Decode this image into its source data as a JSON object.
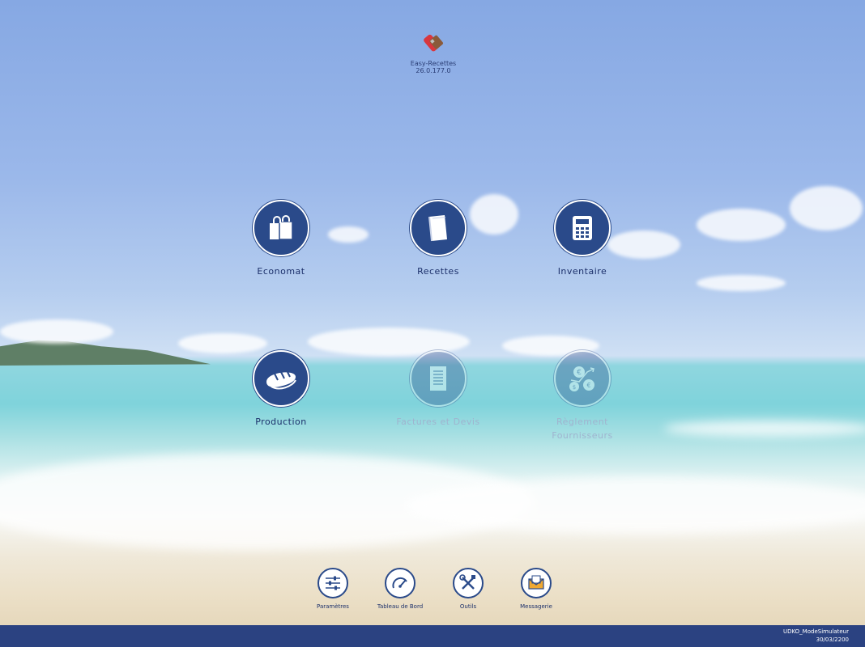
{
  "desktop": {
    "app_name": "Easy-Recettes",
    "app_version": "26.0.177.0"
  },
  "modules": [
    {
      "label": "Economat",
      "icon": "shopping-bag-icon",
      "enabled": true
    },
    {
      "label": "Recettes",
      "icon": "book-icon",
      "enabled": true
    },
    {
      "label": "Inventaire",
      "icon": "calculator-icon",
      "enabled": true
    },
    {
      "label": "Production",
      "icon": "bread-icon",
      "enabled": true
    },
    {
      "label": "Factures et Devis",
      "icon": "document-icon",
      "enabled": false
    },
    {
      "label": "Règlement Fournisseurs",
      "icon": "money-bags-icon",
      "enabled": false
    }
  ],
  "toolbar": [
    {
      "label": "Paramètres",
      "icon": "sliders-icon"
    },
    {
      "label": "Tableau de Bord",
      "icon": "gauge-icon"
    },
    {
      "label": "Outils",
      "icon": "tools-icon"
    },
    {
      "label": "Messagerie",
      "icon": "envelope-icon"
    }
  ],
  "status_bar": {
    "user": "UDKO_ModeSimulateur",
    "date": "30/03/2200"
  },
  "colors": {
    "accent": "#2a4a8a",
    "status_bar": "#2b4281",
    "label_text": "#1b2f6a"
  }
}
